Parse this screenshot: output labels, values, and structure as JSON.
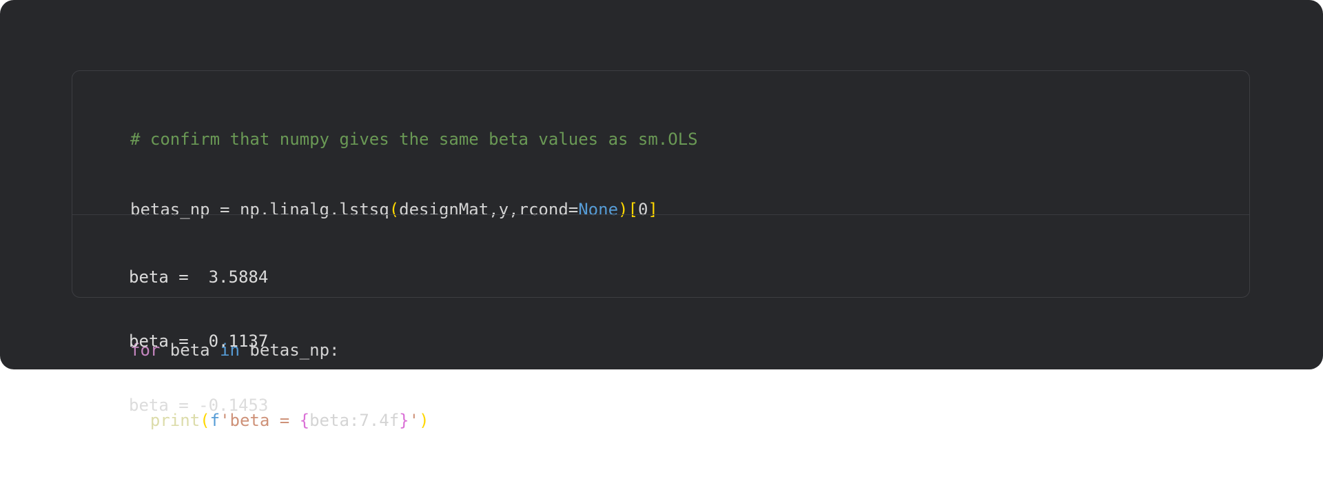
{
  "colors": {
    "background": "#27282b",
    "cell_border": "#3d3e42",
    "comment": "#6a9955",
    "keyword": "#c586c0",
    "builtin_const": "#569cd6",
    "function": "#dcdcaa",
    "string": "#ce9178",
    "bracket": "#ffd700",
    "brace": "#da70d6",
    "text": "#d4d4d4"
  },
  "code": {
    "line1": {
      "comment": "# confirm that numpy gives the same beta values as sm.OLS"
    },
    "line2": {
      "t1": "betas_np = np.linalg.lstsq",
      "paren_open": "(",
      "t2": "designMat,y,rcond=",
      "none_kw": "None",
      "paren_close": ")",
      "bracket_open": "[",
      "index": "0",
      "bracket_close": "]"
    },
    "line3": {
      "blank": ""
    },
    "line4": {
      "for_kw": "for",
      "t1": " beta ",
      "in_kw": "in",
      "t2": " betas_np:"
    },
    "line5": {
      "indent": "  ",
      "func": "print",
      "paren_open": "(",
      "fprefix": "f",
      "str_open": "'beta = ",
      "brace_open": "{",
      "expr": "beta:7.4f",
      "brace_close": "}",
      "str_close": "'",
      "paren_close": ")"
    }
  },
  "output": {
    "lines": [
      "beta =  3.5884",
      "beta =  0.1137",
      "beta = -0.1453"
    ]
  }
}
